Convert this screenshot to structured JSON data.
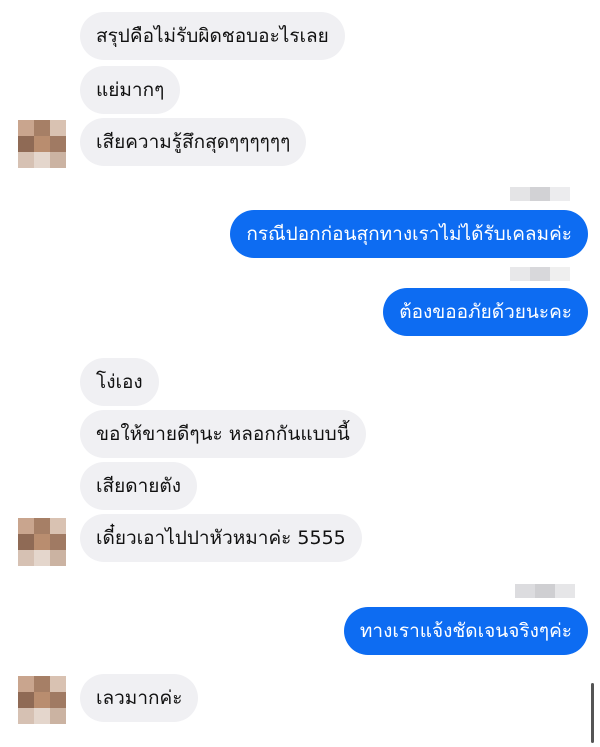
{
  "conversation": {
    "messages": [
      {
        "sender": "other",
        "text": "สรุปคือไม่รับผิดชอบอะไรเลย"
      },
      {
        "sender": "other",
        "text": "แย่มากๆ"
      },
      {
        "sender": "other",
        "text": "เสียความรู้สึกสุดๆๆๆๆๆๆ"
      },
      {
        "sender": "me",
        "text": "กรณีปอกก่อนสุกทางเราไม่ได้รับเคลมค่ะ"
      },
      {
        "sender": "me",
        "text": "ต้องขออภัยด้วยนะคะ"
      },
      {
        "sender": "other",
        "text": "โง่เอง"
      },
      {
        "sender": "other",
        "text": "ขอให้ขายดีๆนะ หลอกกันแบบนี้"
      },
      {
        "sender": "other",
        "text": "เสียดายตัง"
      },
      {
        "sender": "other",
        "text": "เดี๋ยวเอาไปปาหัวหมาค่ะ 5555"
      },
      {
        "sender": "me",
        "text": "ทางเราแจ้งชัดเจนจริงๆค่ะ"
      },
      {
        "sender": "other",
        "text": "เลวมากค่ะ"
      }
    ]
  },
  "colors": {
    "outgoing_bubble": "#0d6cf2",
    "incoming_bubble": "#f0f0f3",
    "background": "#ffffff"
  },
  "icons": {
    "avatar": "blurred-avatar-icon",
    "seen_indicator": "blurred-seen-indicator"
  }
}
